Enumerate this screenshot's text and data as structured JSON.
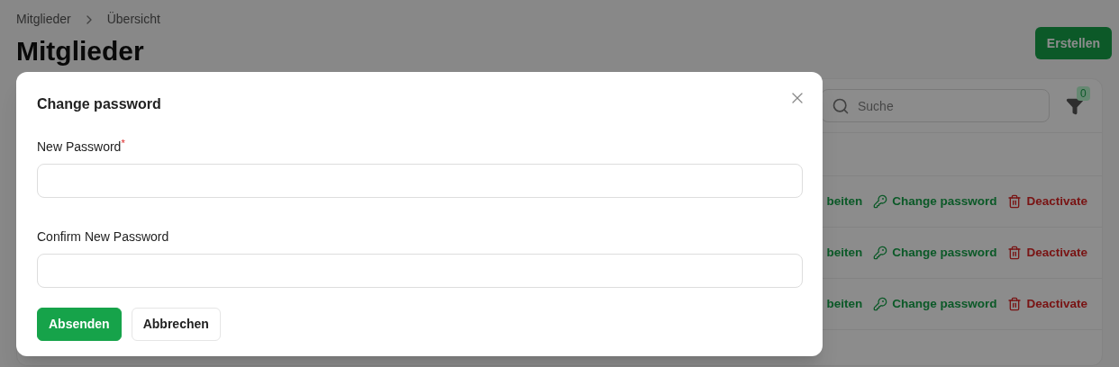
{
  "breadcrumb": [
    "Mitglieder",
    "Übersicht"
  ],
  "page_title": "Mitglieder",
  "create_button": "Erstellen",
  "search": {
    "placeholder": "Suche"
  },
  "filter": {
    "count": "0"
  },
  "rows": [
    {
      "edit": "beiten",
      "change_password": "Change password",
      "deactivate": "Deactivate"
    },
    {
      "edit": "beiten",
      "change_password": "Change password",
      "deactivate": "Deactivate"
    },
    {
      "edit": "beiten",
      "change_password": "Change password",
      "deactivate": "Deactivate"
    }
  ],
  "dialog": {
    "title": "Change password",
    "fields": [
      {
        "label": "New Password",
        "required_mark": "*"
      },
      {
        "label": "Confirm New Password"
      }
    ],
    "buttons": [
      {
        "label": "Absenden",
        "kind": "primary"
      },
      {
        "label": "Abbrechen",
        "kind": "secondary"
      }
    ]
  }
}
